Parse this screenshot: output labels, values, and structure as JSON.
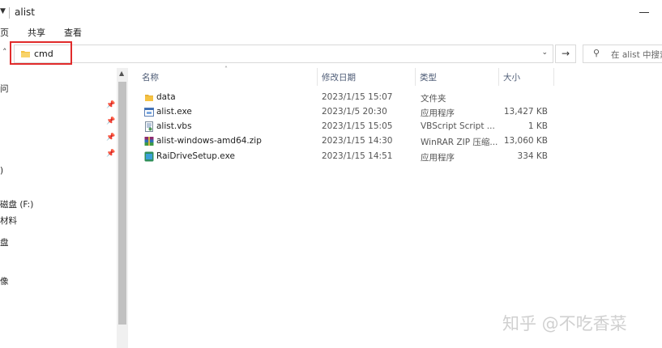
{
  "window": {
    "title": "alist"
  },
  "ribbon": {
    "tabs": [
      "页",
      "共享",
      "查看"
    ]
  },
  "address": {
    "value": "cmd"
  },
  "search": {
    "placeholder": "在 alist 中搜索"
  },
  "nav": {
    "items": [
      "问",
      ")",
      "磁盘 (F:)",
      "材料",
      "盘",
      "像"
    ]
  },
  "columns": {
    "name": "名称",
    "date": "修改日期",
    "type": "类型",
    "size": "大小"
  },
  "files": [
    {
      "name": "data",
      "date": "2023/1/15 15:07",
      "type": "文件夹",
      "size": "",
      "icon": "folder-icon"
    },
    {
      "name": "alist.exe",
      "date": "2023/1/5 20:30",
      "type": "应用程序",
      "size": "13,427 KB",
      "icon": "exe-icon"
    },
    {
      "name": "alist.vbs",
      "date": "2023/1/15 15:05",
      "type": "VBScript Script ...",
      "size": "1 KB",
      "icon": "vbs-icon"
    },
    {
      "name": "alist-windows-amd64.zip",
      "date": "2023/1/15 14:30",
      "type": "WinRAR ZIP 压缩...",
      "size": "13,060 KB",
      "icon": "winrar-icon"
    },
    {
      "name": "RaiDriveSetup.exe",
      "date": "2023/1/15 14:51",
      "type": "应用程序",
      "size": "334 KB",
      "icon": "raidrive-icon"
    }
  ],
  "watermark": "知乎 @不吃香菜",
  "colors": {
    "highlight_box": "#e12b2b",
    "folder": "#f5c242",
    "header_text": "#4d5b75"
  }
}
